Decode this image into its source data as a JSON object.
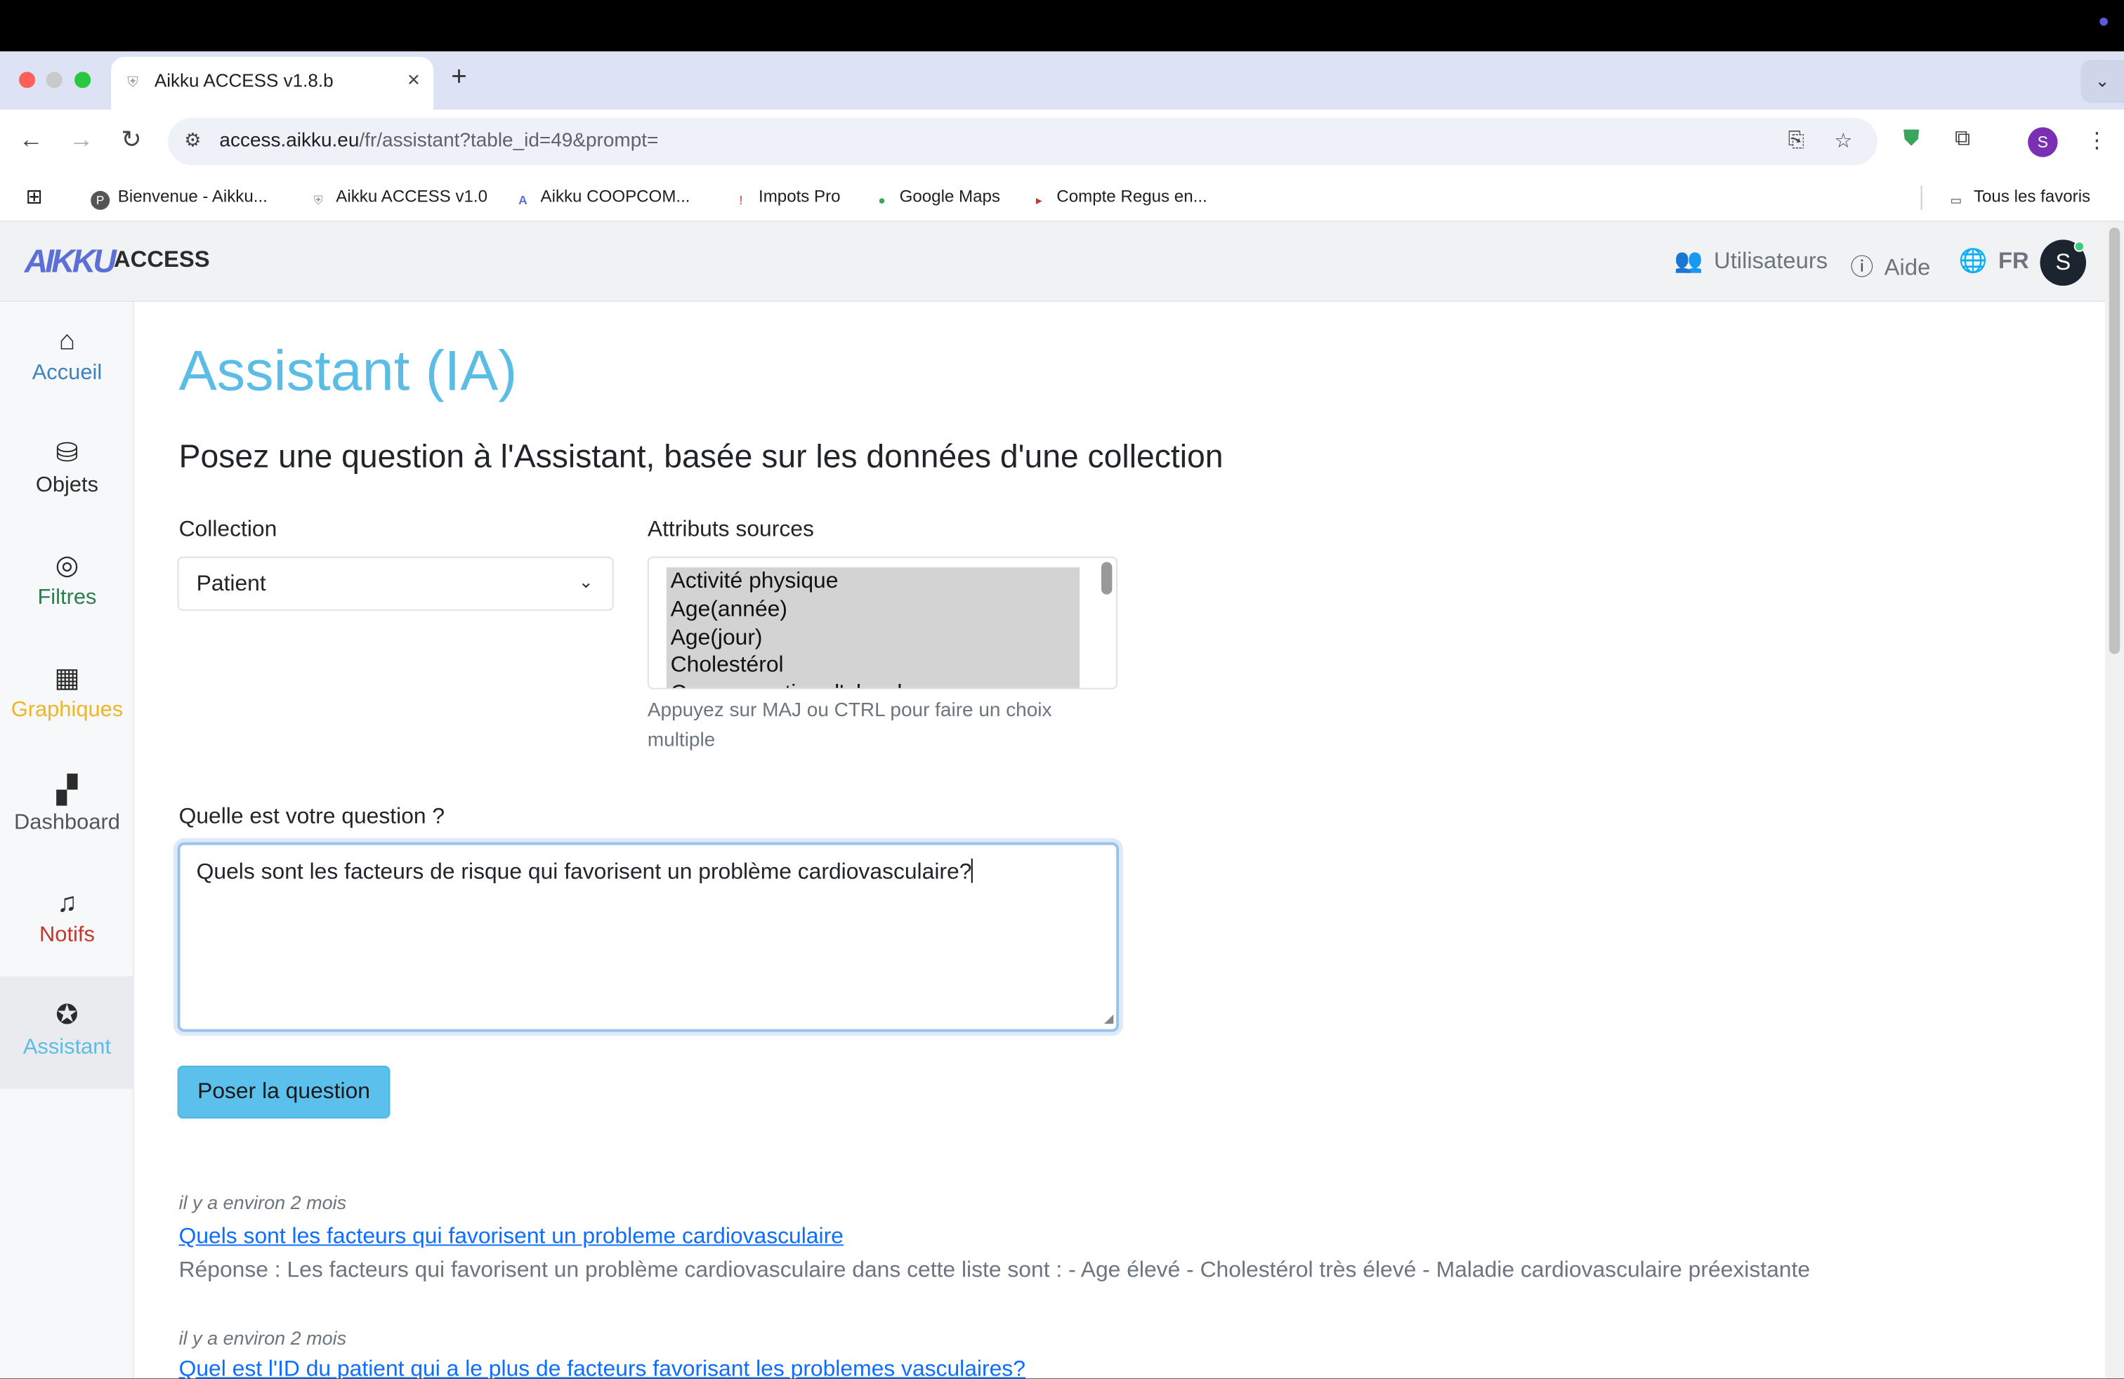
{
  "browser": {
    "tab_title": "Aikku ACCESS v1.8.b",
    "url_host": "access.aikku.eu",
    "url_path": "/fr/assistant?table_id=49&prompt=",
    "profile_initial": "S"
  },
  "bookmarks": [
    {
      "label": "Bienvenue - Aikku...",
      "icon": "P",
      "color": "#555555"
    },
    {
      "label": "Aikku ACCESS v1.0",
      "icon": "⛨",
      "color": "#9aa0a6"
    },
    {
      "label": "Aikku COOPCOM...",
      "icon": "A",
      "color": "#5b6fd6"
    },
    {
      "label": "Impots Pro",
      "icon": "!",
      "color": "#c0392b"
    },
    {
      "label": "Google Maps",
      "icon": "●",
      "color": "#34a853"
    },
    {
      "label": "Compte Regus en...",
      "icon": "\\",
      "color": "#c0392b"
    }
  ],
  "bookmarks_all": "Tous les favoris",
  "app": {
    "brand": "ACCESS",
    "logo_mark": "AIKKU",
    "header": {
      "users": "Utilisateurs",
      "help": "Aide",
      "lang": "FR",
      "avatar_initial": "S"
    }
  },
  "sidebar": [
    {
      "label": "Accueil",
      "icon": "⌂",
      "color": "#3b82c4"
    },
    {
      "label": "Objets",
      "icon": "⛁",
      "color": "#2b2b2b"
    },
    {
      "label": "Filtres",
      "icon": "◎",
      "color": "#2e7d4f"
    },
    {
      "label": "Graphiques",
      "icon": "▦",
      "color": "#f0b429"
    },
    {
      "label": "Dashboard",
      "icon": "▞",
      "color": "#555555"
    },
    {
      "label": "Notifs",
      "icon": "🔔",
      "color": "#c0392b"
    },
    {
      "label": "Assistant",
      "icon": "✪",
      "color": "#5bbde6"
    }
  ],
  "page": {
    "title": "Assistant (IA)",
    "subtitle": "Posez une question à l'Assistant, basée sur les données d'une collection",
    "collection_label": "Collection",
    "collection_value": "Patient",
    "attributes_label": "Attributs sources",
    "attributes": [
      "Activité physique",
      "Age(année)",
      "Age(jour)",
      "Cholestérol",
      "Consommation d'alcool"
    ],
    "attributes_help": "Appuyez sur MAJ ou CTRL pour faire un choix multiple",
    "question_label": "Quelle est votre question ?",
    "question_value": "Quels sont les facteurs de risque qui favorisent un problème cardiovasculaire?",
    "submit_label": "Poser la question"
  },
  "history": [
    {
      "time": "il y a environ 2 mois",
      "question": "Quels sont les facteurs qui favorisent un probleme cardiovasculaire",
      "answer": "Réponse : Les facteurs qui favorisent un problème cardiovasculaire dans cette liste sont : - Age élevé - Cholestérol très élevé - Maladie cardiovasculaire préexistante"
    },
    {
      "time": "il y a environ 2 mois",
      "question": "Quel est l'ID du patient qui a le plus de facteurs favorisant les problemes vasculaires?",
      "answer": ""
    }
  ]
}
